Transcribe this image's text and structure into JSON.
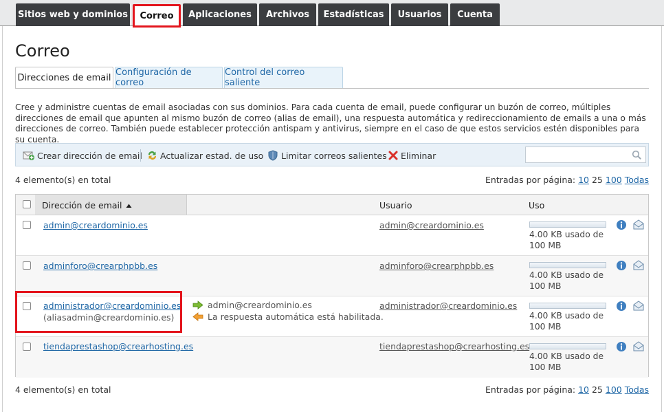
{
  "nav": {
    "tabs": [
      {
        "label": "Sitios web y dominios",
        "active": false
      },
      {
        "label": "Correo",
        "active": true
      },
      {
        "label": "Aplicaciones",
        "active": false
      },
      {
        "label": "Archivos",
        "active": false
      },
      {
        "label": "Estadísticas",
        "active": false
      },
      {
        "label": "Usuarios",
        "active": false
      },
      {
        "label": "Cuenta",
        "active": false
      }
    ]
  },
  "page": {
    "title": "Correo"
  },
  "subtabs": [
    {
      "label": "Direcciones de email",
      "active": true
    },
    {
      "label": "Configuración de correo",
      "active": false
    },
    {
      "label": "Control del correo saliente",
      "active": false
    }
  ],
  "description": "Cree y administre cuentas de email asociadas con sus dominios. Para cada cuenta de email, puede configurar un buzón de correo, múltiples direcciones de email que apunten al mismo buzón de correo (alias de email), una respuesta automática y redireccionamiento de emails a una o más direcciones de correo. También puede establecer protección antispam y antivirus, siempre en el caso de que estos servicios estén disponibles para su cuenta.",
  "toolbar": {
    "create_label": "Crear dirección de email",
    "refresh_label": "Actualizar estad. de uso",
    "limit_label": "Limitar correos salientes",
    "delete_label": "Eliminar",
    "search_placeholder": ""
  },
  "summary": {
    "total_text": "4 elemento(s) en total",
    "per_page_label": "Entradas por página:",
    "per_page_options": [
      "10",
      "25",
      "100",
      "Todas"
    ],
    "per_page_selected": "25"
  },
  "table": {
    "headers": {
      "email": "Dirección de email",
      "user": "Usuario",
      "usage": "Uso"
    },
    "rows": [
      {
        "email": "admin@creardominio.es",
        "alias": "",
        "forward": "",
        "autoreply": "",
        "user": "admin@creardominio.es",
        "usage": "4.00 KB usado de 100 MB",
        "usage_fraction": 0.0
      },
      {
        "email": "adminforo@crearphpbb.es",
        "alias": "",
        "forward": "",
        "autoreply": "",
        "user": "adminforo@crearphpbb.es",
        "usage": "4.00 KB usado de 100 MB",
        "usage_fraction": 0.0
      },
      {
        "email": "administrador@creardominio.es",
        "alias": "(aliasadmin@creardominio.es)",
        "forward": "admin@creardominio.es",
        "autoreply": "La respuesta automática está habilitada.",
        "user": "administrador@creardominio.es",
        "usage": "4.00 KB usado de 100 MB",
        "usage_fraction": 0.0
      },
      {
        "email": "tiendaprestashop@crearhosting.es",
        "alias": "",
        "forward": "",
        "autoreply": "",
        "user": "tiendaprestashop@crearhosting.es",
        "usage": "4.00 KB usado de 100 MB",
        "usage_fraction": 0.0
      }
    ]
  },
  "colors": {
    "accent": "#1f67a6",
    "highlight": "#e3141c",
    "nav_bg": "#3b3d40"
  }
}
